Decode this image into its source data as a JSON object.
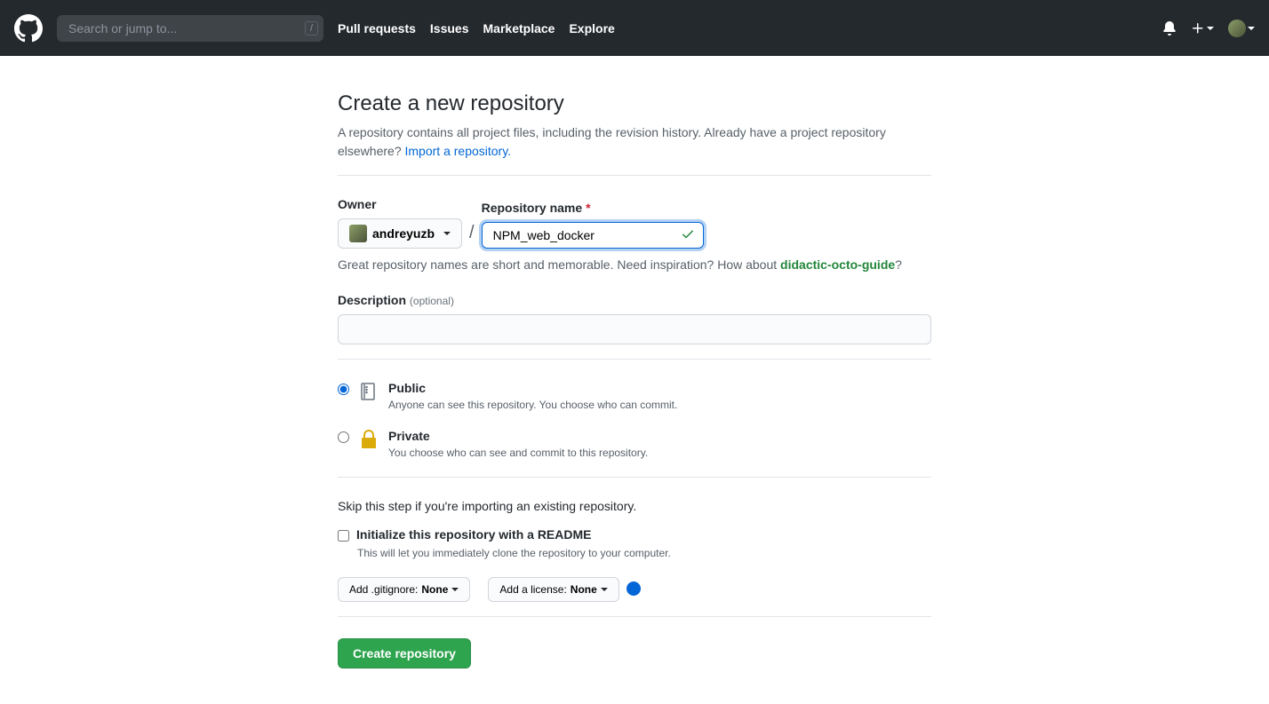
{
  "header": {
    "search_placeholder": "Search or jump to...",
    "slash_key": "/",
    "nav": {
      "pull_requests": "Pull requests",
      "issues": "Issues",
      "marketplace": "Marketplace",
      "explore": "Explore"
    }
  },
  "page": {
    "title": "Create a new repository",
    "subtitle_a": "A repository contains all project files, including the revision history. Already have a project repository elsewhere? ",
    "import_link": "Import a repository.",
    "owner_label": "Owner",
    "owner_value": "andreyuzb",
    "slash": "/",
    "repo_name_label": "Repository name",
    "required_mark": "*",
    "repo_name_value": "NPM_web_docker",
    "hint_a": "Great repository names are short and memorable. Need inspiration? How about ",
    "suggestion": "didactic-octo-guide",
    "hint_q": "?",
    "desc_label": "Description",
    "desc_optional": "(optional)",
    "desc_value": "",
    "visibility": {
      "public_title": "Public",
      "public_sub": "Anyone can see this repository. You choose who can commit.",
      "private_title": "Private",
      "private_sub": "You choose who can see and commit to this repository."
    },
    "skip_text": "Skip this step if you're importing an existing repository.",
    "readme_label": "Initialize this repository with a README",
    "readme_sub": "This will let you immediately clone the repository to your computer.",
    "gitignore_prefix": "Add .gitignore: ",
    "gitignore_value": "None",
    "license_prefix": "Add a license: ",
    "license_value": "None",
    "submit": "Create repository"
  }
}
